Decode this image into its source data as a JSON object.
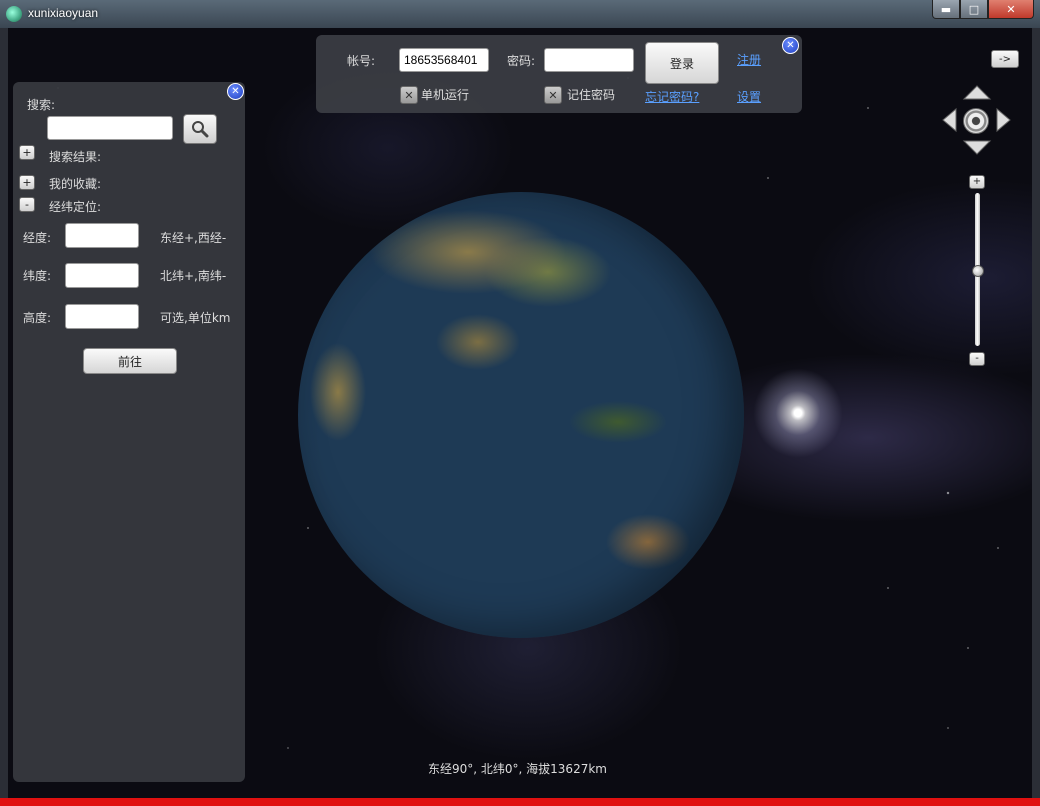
{
  "window": {
    "title": "xunixiaoyuan",
    "min": "▬",
    "max": "□",
    "close": "✕"
  },
  "login": {
    "account_label": "帐号:",
    "account_value": "18653568401",
    "password_label": "密码:",
    "password_value": "",
    "login_button": "登录",
    "register_link": "注册",
    "offline_label": "单机运行",
    "remember_label": "记住密码",
    "forgot_link": "忘记密码?",
    "settings_link": "设置",
    "check_mark": "✕",
    "close_glyph": "✕"
  },
  "panel": {
    "close_glyph": "✕",
    "search_label": "搜索:",
    "search_value": "",
    "search_results_label": "搜索结果:",
    "favorites_label": "我的收藏:",
    "coord_label": "经纬定位:",
    "expand_glyph": "+",
    "collapse_glyph": "-",
    "longitude_label": "经度:",
    "longitude_hint": "东经+,西经-",
    "latitude_label": "纬度:",
    "latitude_hint": "北纬+,南纬-",
    "altitude_label": "高度:",
    "altitude_hint": "可选,单位km",
    "go_button": "前往"
  },
  "nav": {
    "toggle_button": "->",
    "zoom_in": "+",
    "zoom_out": "-",
    "zoom_level": 0.5
  },
  "status": {
    "text": "东经90°, 北纬0°, 海拔13627km"
  },
  "colors": {
    "accent_link": "#5aa0ff",
    "close_blue": "#1f3fc0",
    "bottom_bar": "#e01010"
  }
}
